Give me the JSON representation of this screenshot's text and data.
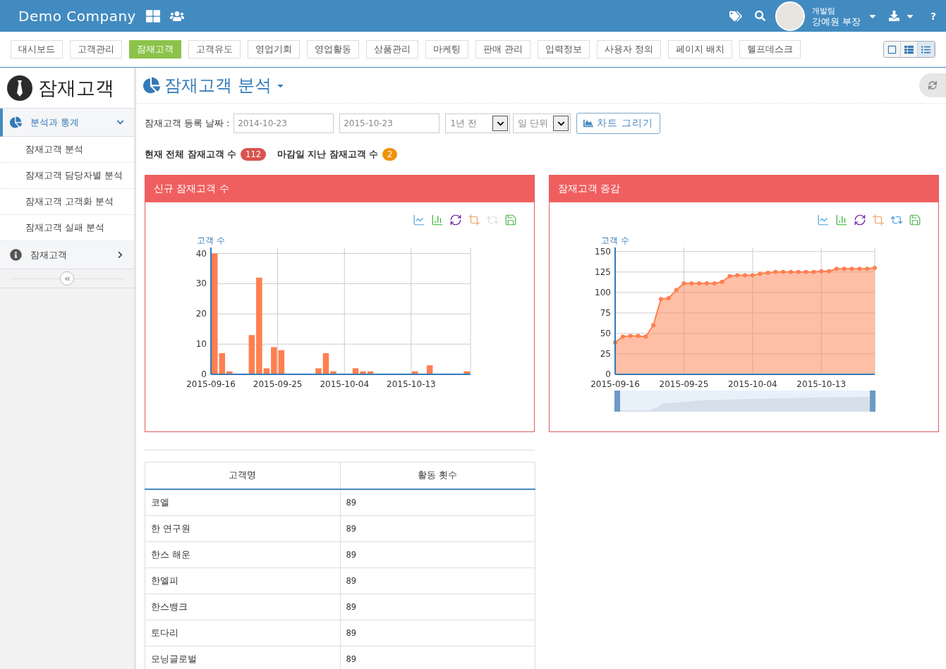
{
  "header": {
    "brand": "Demo Company",
    "user": {
      "team": "개발팀",
      "name": "강예원 부장"
    },
    "help": "?"
  },
  "menu": [
    {
      "label": "대시보드",
      "selected": false
    },
    {
      "label": "고객관리",
      "selected": false
    },
    {
      "label": "잠재고객",
      "selected": true
    },
    {
      "label": "고객유도",
      "selected": false
    },
    {
      "label": "영업기회",
      "selected": false
    },
    {
      "label": "영업활동",
      "selected": false
    },
    {
      "label": "상품관리",
      "selected": false
    },
    {
      "label": "마케팅",
      "selected": false
    },
    {
      "label": "판매 관리",
      "selected": false
    },
    {
      "label": "입력정보",
      "selected": false
    },
    {
      "label": "사용자 정의",
      "selected": false
    },
    {
      "label": "페이지 배치",
      "selected": false
    },
    {
      "label": "헬프데스크",
      "selected": false
    }
  ],
  "view_buttons": [
    {
      "kind": "single",
      "selected": false
    },
    {
      "kind": "grid",
      "selected": false
    },
    {
      "kind": "list",
      "selected": true
    }
  ],
  "sidebar": {
    "title": "잠재고객",
    "groups": [
      {
        "kind": "pie",
        "label": "분석과 통계",
        "selected": true,
        "expanded": true,
        "children": [
          {
            "label": "잠재고객 분석"
          },
          {
            "label": "잠재고객 담당자별 분석"
          },
          {
            "label": "잠재고객 고객화 분석"
          },
          {
            "label": "잠재고객 실패 분석"
          }
        ]
      },
      {
        "kind": "info",
        "label": "잠재고객",
        "selected": false,
        "expanded": false
      }
    ]
  },
  "page": {
    "title": "잠재고객 분석"
  },
  "filter": {
    "label": "잠재고객 등록 날짜 :",
    "from": "2014-10-23",
    "to": "2015-10-23",
    "period": "1년 전",
    "unit": "일 단위",
    "button": "차트 그리기"
  },
  "stats": [
    {
      "label": "현재 전체 잠재고객 수",
      "count": "112",
      "color": "#d9534f"
    },
    {
      "label": "마감일 지난 잠재고객 수",
      "count": "2",
      "color": "#f0920a"
    }
  ],
  "panels": [
    {
      "title": "신규 잠재고객 수",
      "navigator": false,
      "toolbar": [
        {
          "kind": "line",
          "disabled": false
        },
        {
          "kind": "bar",
          "disabled": false
        },
        {
          "kind": "refresh",
          "disabled": false
        },
        {
          "kind": "zoom",
          "disabled": false
        },
        {
          "kind": "restore",
          "disabled": true
        },
        {
          "kind": "save",
          "disabled": false
        }
      ],
      "chart_data": {
        "type": "bar",
        "grid": true,
        "ylabel": "고객 수",
        "categories": [
          "2015-09-16",
          null,
          null,
          null,
          null,
          null,
          null,
          null,
          null,
          "2015-09-25",
          null,
          null,
          null,
          null,
          null,
          null,
          null,
          null,
          "2015-10-04",
          null,
          null,
          null,
          null,
          null,
          null,
          null,
          null,
          "2015-10-13",
          null,
          null,
          null,
          null,
          null,
          null,
          null
        ],
        "ylim": [
          0,
          42
        ],
        "yticks": [
          0,
          10,
          20,
          30,
          40
        ],
        "series": [
          {
            "color": "#ff7f50",
            "values": [
              40,
              7,
              1,
              0,
              0,
              13,
              32,
              2,
              9,
              8,
              0,
              0,
              0,
              0,
              2,
              7,
              1,
              0,
              0,
              2,
              1,
              1,
              0,
              0,
              0,
              0,
              0,
              1,
              0,
              3,
              0,
              0,
              0,
              0,
              1
            ]
          }
        ]
      }
    },
    {
      "title": "잠재고객 증감",
      "navigator": true,
      "toolbar": [
        {
          "kind": "line",
          "disabled": false
        },
        {
          "kind": "bar",
          "disabled": false
        },
        {
          "kind": "refresh",
          "disabled": false
        },
        {
          "kind": "zoom",
          "disabled": false
        },
        {
          "kind": "restore",
          "disabled": false
        },
        {
          "kind": "save",
          "disabled": false
        }
      ],
      "chart_data": {
        "type": "area",
        "grid": true,
        "ylabel": "고객 수",
        "categories": [
          "2015-09-16",
          null,
          null,
          null,
          null,
          null,
          null,
          null,
          null,
          "2015-09-25",
          null,
          null,
          null,
          null,
          null,
          null,
          null,
          null,
          "2015-10-04",
          null,
          null,
          null,
          null,
          null,
          null,
          null,
          null,
          "2015-10-13",
          null,
          null,
          null,
          null,
          null,
          null,
          null
        ],
        "ylim": [
          0,
          155
        ],
        "yticks": [
          0,
          25,
          50,
          75,
          100,
          125,
          150
        ],
        "series": [
          {
            "color": "#ff7f50",
            "values": [
              39,
              46,
              47,
              47,
              46,
              60,
              92,
              93,
              103,
              111,
              111,
              111,
              111,
              111,
              113,
              120,
              121,
              121,
              121,
              123,
              124,
              125,
              125,
              125,
              125,
              125,
              125,
              126,
              126,
              129,
              129,
              129,
              129,
              129,
              130
            ]
          }
        ]
      }
    }
  ],
  "table": {
    "columns": [
      "고객명",
      "활동 횟수"
    ],
    "rows": [
      [
        "코엘",
        "89"
      ],
      [
        "한 연구원",
        "89"
      ],
      [
        "한스 해운",
        "89"
      ],
      [
        "한엘피",
        "89"
      ],
      [
        "한스뱅크",
        "89"
      ],
      [
        "토다리",
        "89"
      ],
      [
        "모닝글로벌",
        "89"
      ]
    ]
  }
}
